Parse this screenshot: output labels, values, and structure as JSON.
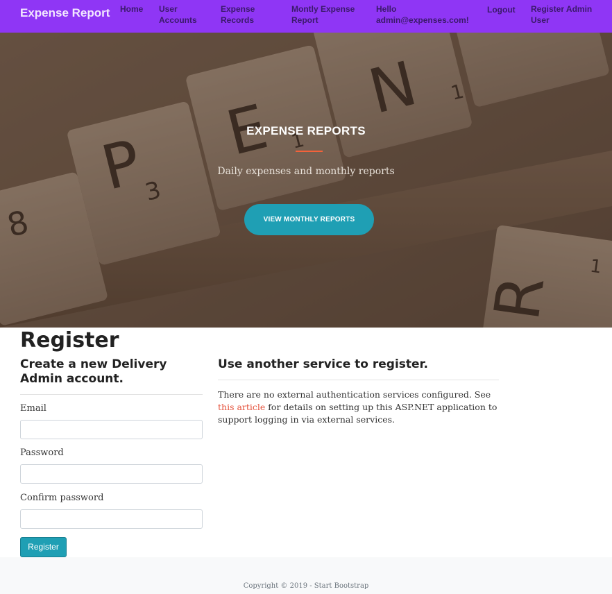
{
  "navbar": {
    "brand": "Expense Report",
    "links": [
      {
        "label": "Home"
      },
      {
        "label": "User Accounts"
      },
      {
        "label": "Expense Records"
      },
      {
        "label": "Montly Expense Report"
      },
      {
        "label": "Hello admin@expenses.com!"
      },
      {
        "label": "Logout"
      },
      {
        "label": "Register Admin User"
      }
    ]
  },
  "hero": {
    "title": "EXPENSE REPORTS",
    "subtitle": "Daily expenses and monthly reports",
    "button_label": "VIEW MONTHLY REPORTS",
    "tiles": [
      {
        "letter": "P",
        "sub": "3"
      },
      {
        "letter": "E",
        "sub": "1"
      },
      {
        "letter": "N",
        "sub": "1"
      },
      {
        "letter": "R",
        "sub": "1"
      },
      {
        "letter": "8",
        "sub": ""
      }
    ]
  },
  "register": {
    "title": "Register",
    "left_heading": "Create a new Delivery Admin account.",
    "fields": [
      {
        "label": "Email",
        "value": ""
      },
      {
        "label": "Password",
        "value": ""
      },
      {
        "label": "Confirm password",
        "value": ""
      }
    ],
    "submit_label": "Register"
  },
  "external": {
    "heading": "Use another service to register.",
    "text_before": "There are no external authentication services configured. See ",
    "link_text": "this article",
    "text_after": " for details on setting up this ASP.NET application to support logging in via external services."
  },
  "footer": {
    "copyright": "Copyright © 2019 - Start Bootstrap"
  },
  "colors": {
    "navbar": "#8f36f5",
    "primary_button": "#1f9fb4",
    "accent": "#f4623a",
    "link": "#e5533d"
  }
}
